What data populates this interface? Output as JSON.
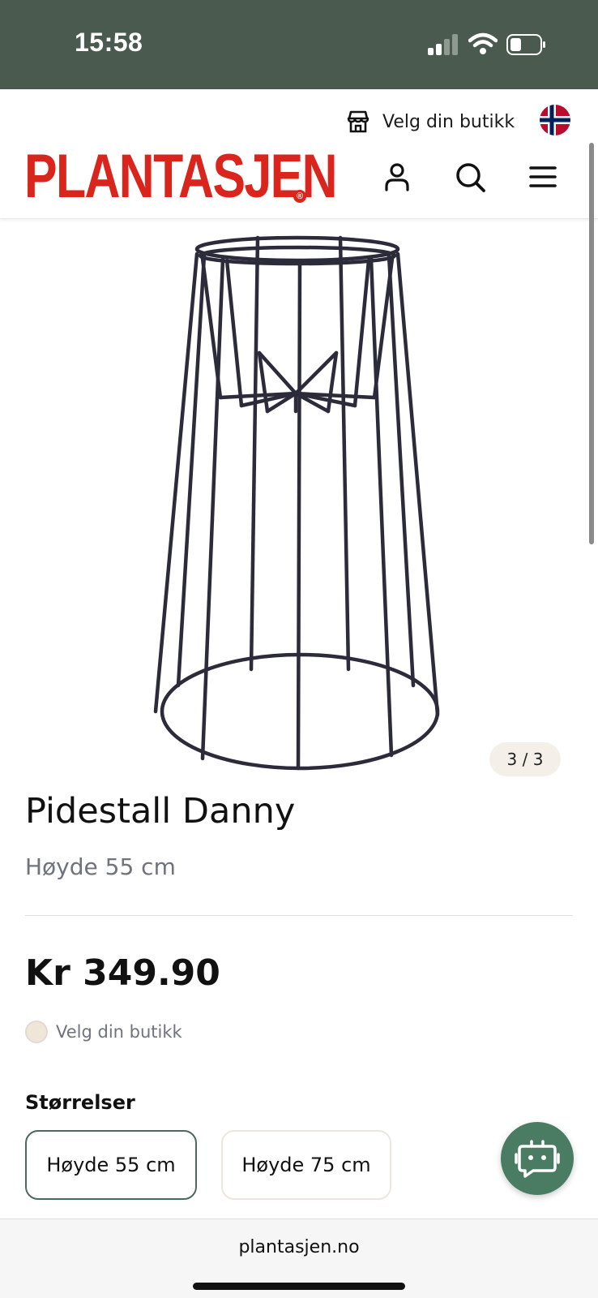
{
  "status_bar": {
    "time": "15:58",
    "icons": [
      "cellular-signal-icon",
      "wifi-icon",
      "battery-icon"
    ]
  },
  "header": {
    "store_link_label": "Velg din butikk",
    "store_icon": "store-icon",
    "language_flag": "norway-flag-icon",
    "logo_text": "PLANTASJEN",
    "logo_mark": "®",
    "icons": [
      "account-icon",
      "search-icon",
      "menu-icon"
    ],
    "brand_color": "#d9251c"
  },
  "gallery": {
    "counter": "3 / 3",
    "image": "plant-stand-product-image"
  },
  "product": {
    "title": "Pidestall Danny",
    "subtitle": "Høyde 55 cm",
    "price": "Kr 349.90",
    "store_availability_label": "Velg din butikk"
  },
  "sizes": {
    "label": "Størrelser",
    "options": [
      {
        "label": "Høyde 55 cm",
        "selected": true
      },
      {
        "label": "Høyde 75 cm",
        "selected": false
      }
    ]
  },
  "chat": {
    "icon": "chat-bot-icon",
    "color": "#4a7c63"
  },
  "browser": {
    "url": "plantasjen.no"
  }
}
